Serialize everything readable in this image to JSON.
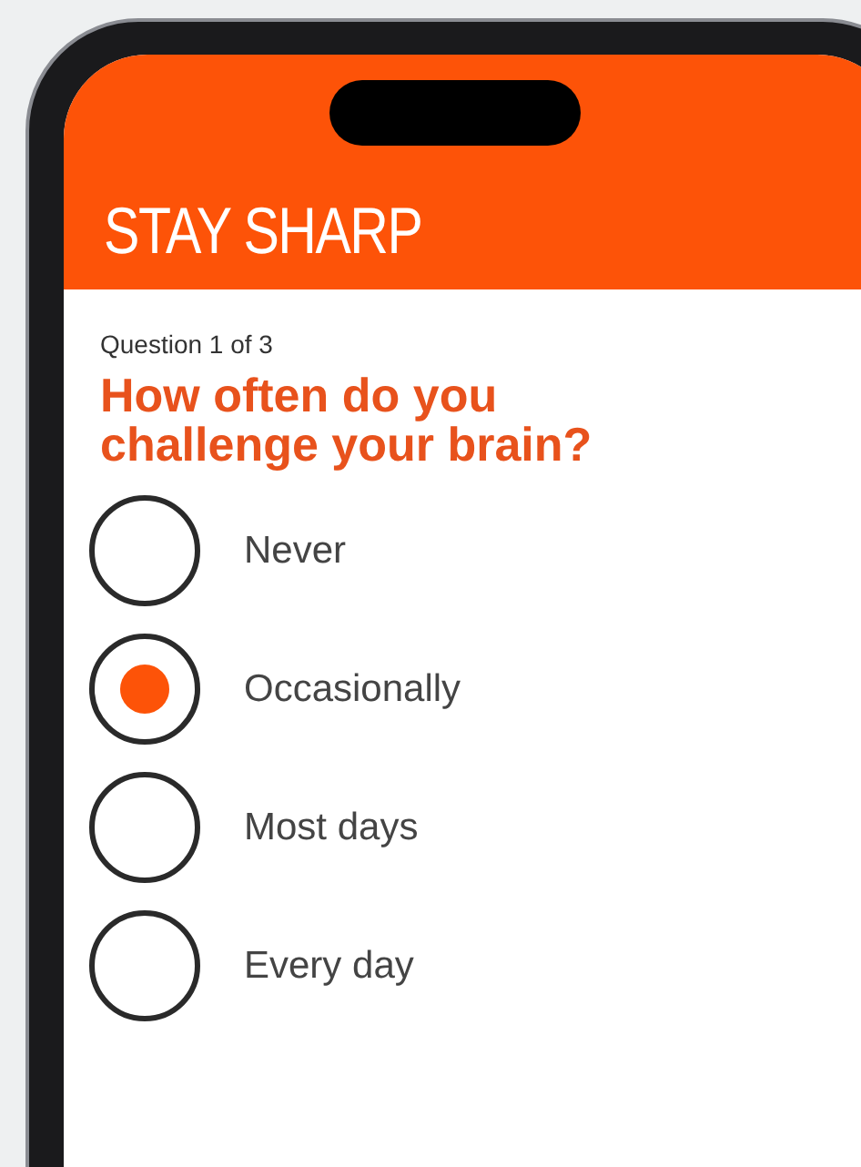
{
  "app_title": "STAY SHARP",
  "progress": "Question 1 of 3",
  "question": "How often do you challenge your brain?",
  "options": [
    {
      "label": "Never",
      "selected": false
    },
    {
      "label": "Occasionally",
      "selected": true
    },
    {
      "label": "Most days",
      "selected": false
    },
    {
      "label": "Every day",
      "selected": false
    }
  ]
}
